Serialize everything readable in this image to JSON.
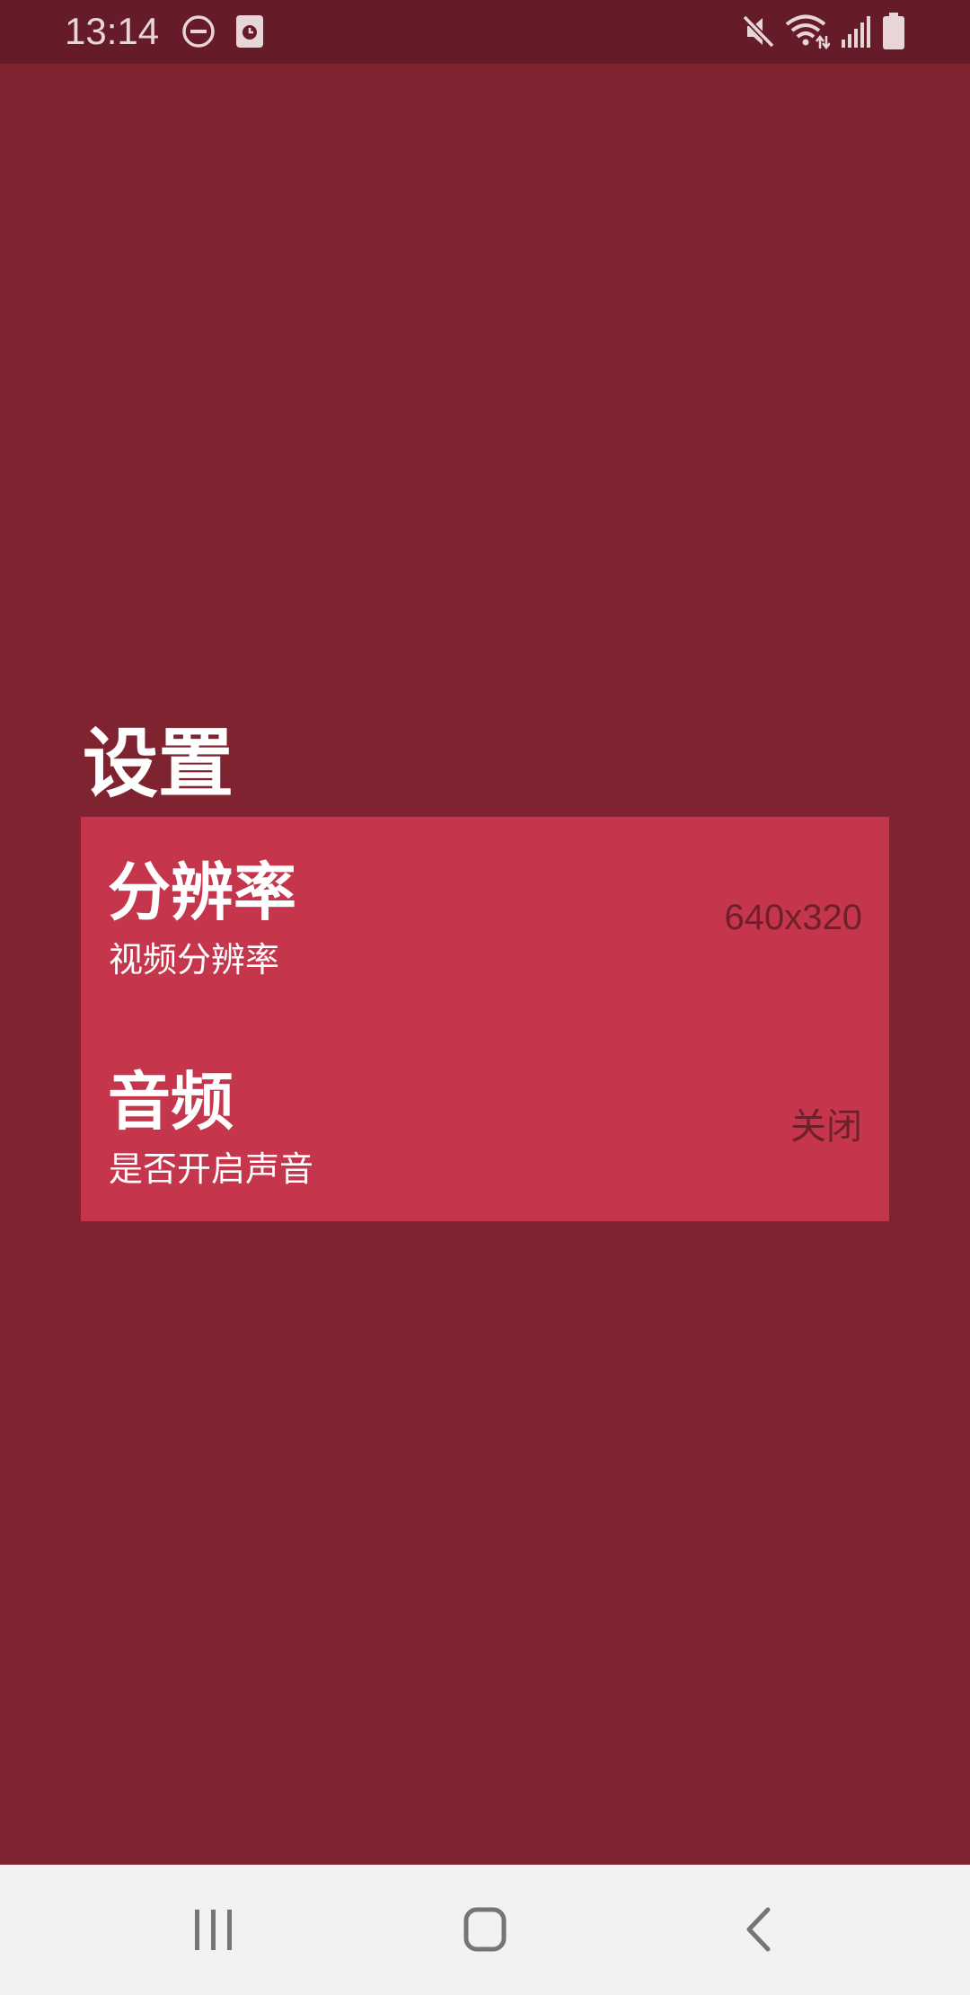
{
  "status_bar": {
    "time": "13:14",
    "icons": [
      "do-not-disturb-icon",
      "app-notification-icon",
      "mute-icon",
      "wifi-icon",
      "signal-icon",
      "battery-icon"
    ]
  },
  "page": {
    "title": "设置"
  },
  "settings": [
    {
      "title": "分辨率",
      "subtitle": "视频分辨率",
      "value": "640x320"
    },
    {
      "title": "音频",
      "subtitle": "是否开启声音",
      "value": "关闭"
    }
  ],
  "nav_bar": {
    "icons": [
      "recent-apps-icon",
      "home-icon",
      "back-icon"
    ]
  },
  "colors": {
    "background": "#802330",
    "status_bar": "#661c28",
    "card": "#c5354c",
    "value_text": "#6d1f2c",
    "nav_bar": "#f2f2f2"
  }
}
